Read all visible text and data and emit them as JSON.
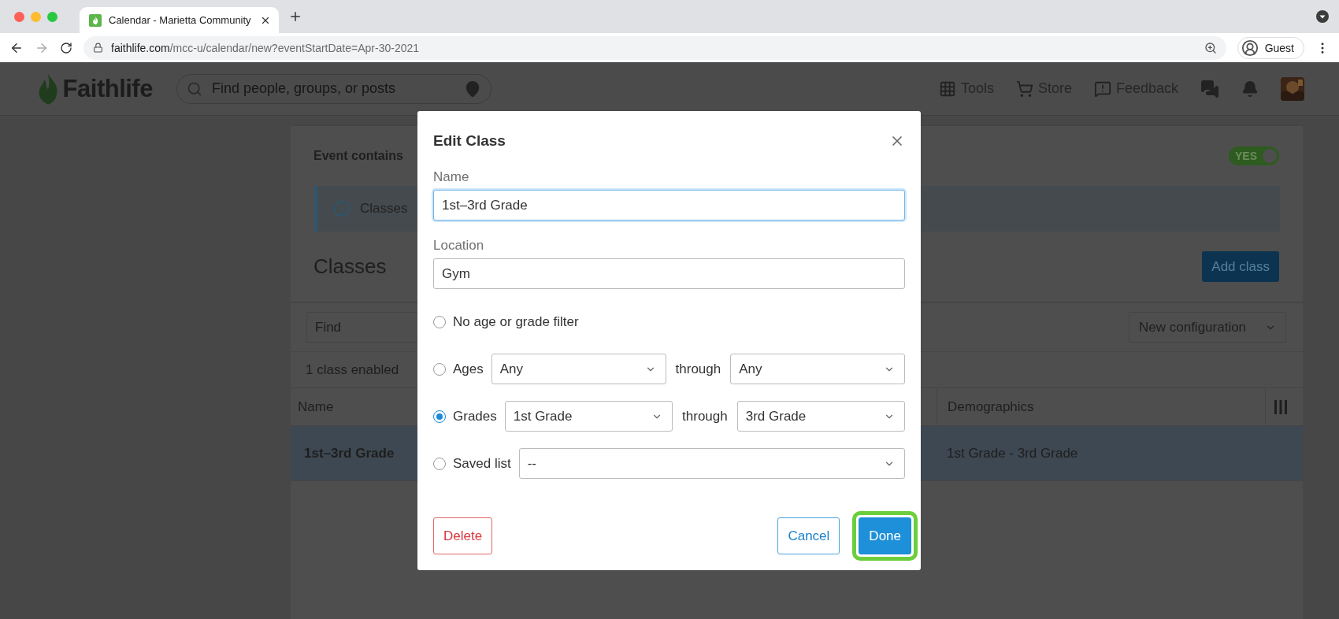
{
  "browser": {
    "tab": {
      "title": "Calendar - Marietta Community"
    },
    "url": {
      "host": "faithlife.com",
      "path": "/mcc-u/calendar/new?eventStartDate=Apr-30-2021"
    },
    "profile": "Guest"
  },
  "header": {
    "logo": "Faithlife",
    "search": {
      "placeholder": "Find people, groups, or posts"
    },
    "nav": [
      {
        "kind": "grid",
        "label": "Tools"
      },
      {
        "kind": "cart",
        "label": "Store"
      },
      {
        "kind": "feedback",
        "label": "Feedback"
      }
    ]
  },
  "page": {
    "event_label": "Event contains",
    "toggle": {
      "label": "YES",
      "on": true
    },
    "info": "Classes",
    "heading": "Classes",
    "add_button": "Add class",
    "find": {
      "placeholder": "Find"
    },
    "configuration": "New configuration",
    "count": "1 class enabled",
    "table": {
      "columns": [
        "Name",
        "Demographics"
      ],
      "rows": [
        {
          "cells": [
            "1st–3rd Grade",
            "1st Grade - 3rd Grade"
          ],
          "selected": true
        }
      ]
    }
  },
  "dialog": {
    "title": "Edit Class",
    "fields": [
      {
        "label": "Name",
        "value": "1st–3rd Grade",
        "focused": true
      },
      {
        "label": "Location",
        "value": "Gym",
        "focused": false
      }
    ],
    "filters": [
      {
        "kind": "none",
        "label": "No age or grade filter",
        "selected": false
      },
      {
        "kind": "range",
        "label": "Ages",
        "from": "Any",
        "joiner": "through",
        "to": "Any",
        "selected": false
      },
      {
        "kind": "range",
        "label": "Grades",
        "from": "1st Grade",
        "joiner": "through",
        "to": "3rd Grade",
        "selected": true
      },
      {
        "kind": "single",
        "label": "Saved list",
        "value": "--",
        "selected": false
      }
    ],
    "buttons": [
      {
        "kind": "danger",
        "label": "Delete",
        "highlighted": false
      },
      {
        "kind": "secondary",
        "label": "Cancel",
        "highlighted": false
      },
      {
        "kind": "primary",
        "label": "Done",
        "highlighted": true
      }
    ]
  }
}
